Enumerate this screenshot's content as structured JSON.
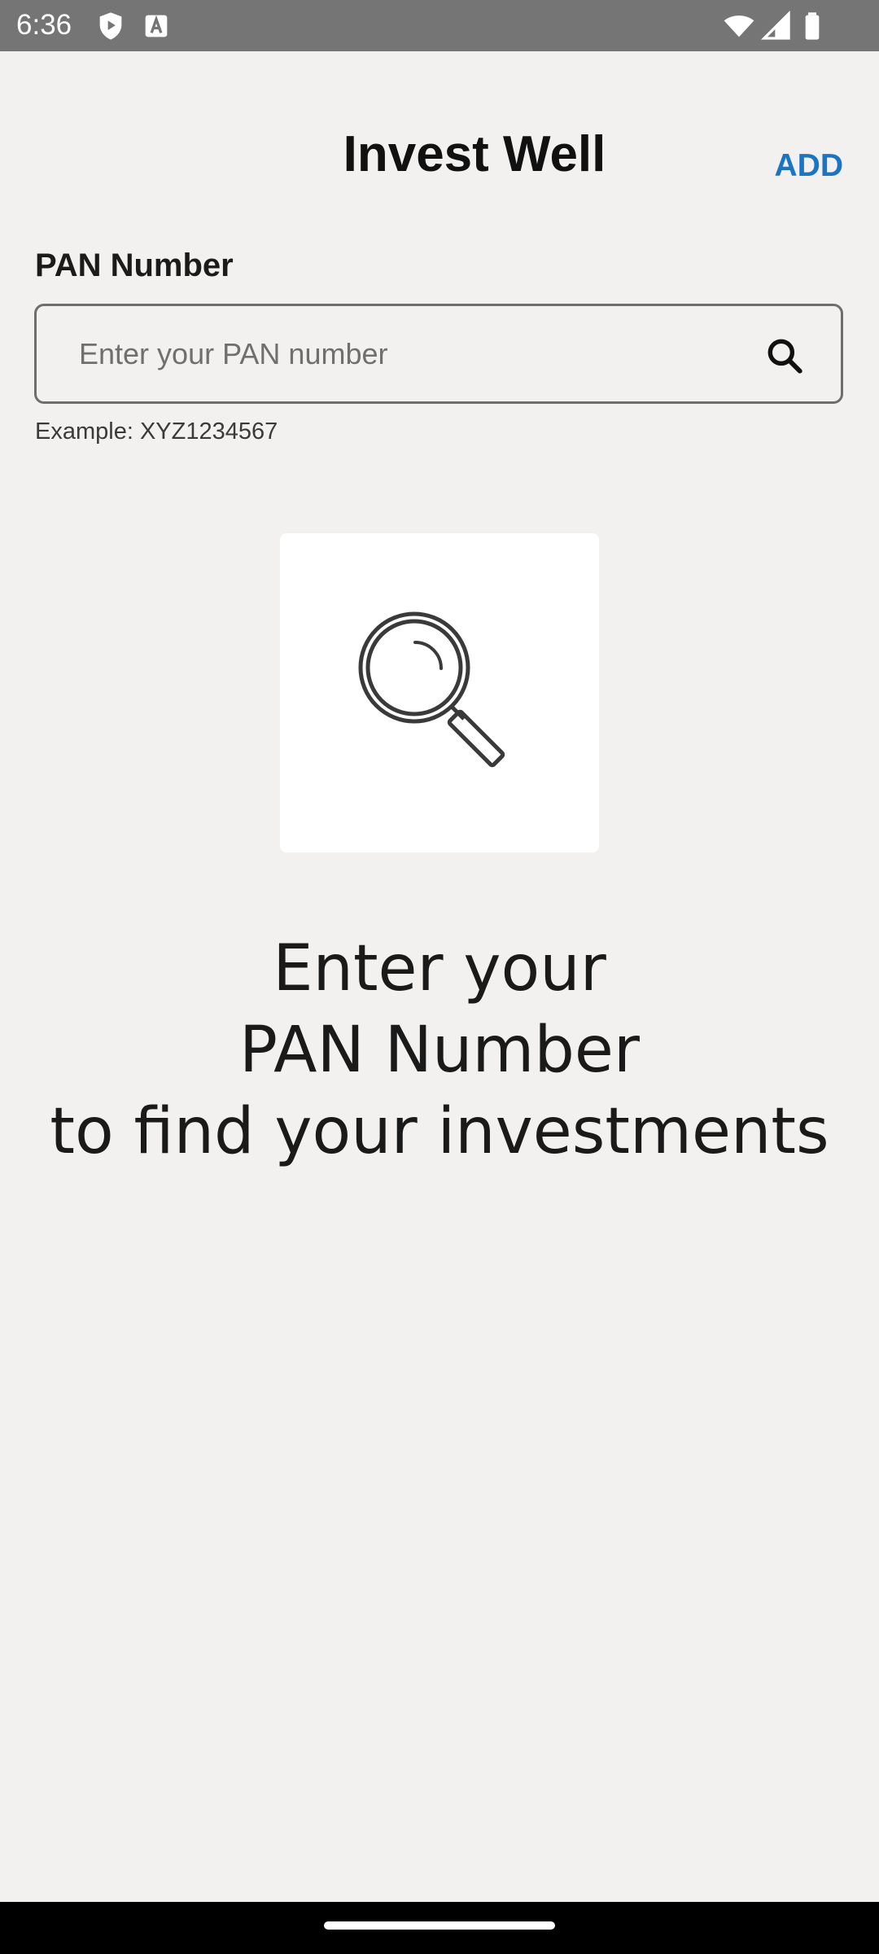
{
  "status_bar": {
    "time": "6:36",
    "icons": [
      "shield-play-icon",
      "text-a-icon",
      "wifi-icon",
      "signal-icon",
      "battery-icon"
    ]
  },
  "header": {
    "title": "Invest Well",
    "add_label": "ADD",
    "accent_color": "#1a75c4"
  },
  "pan_field": {
    "label": "PAN Number",
    "value": "",
    "placeholder": "Enter your PAN number",
    "helper": "Example: XYZ1234567",
    "action_icon": "search-icon"
  },
  "empty_state": {
    "icon": "magnifier-icon",
    "lines": [
      "Enter your",
      "PAN Number",
      "to find your investments"
    ]
  }
}
